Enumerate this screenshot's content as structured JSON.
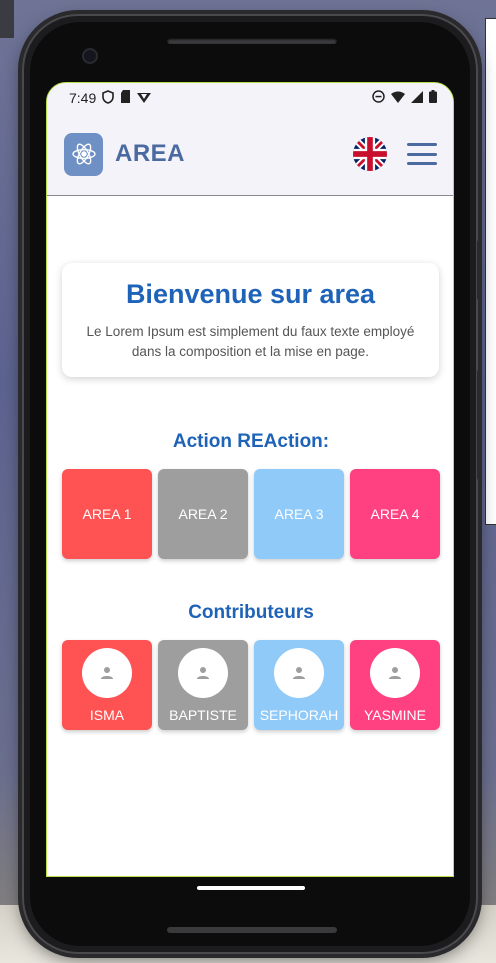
{
  "status_bar": {
    "time": "7:49"
  },
  "appbar": {
    "brand": "AREA",
    "logo_icon": "atom-icon",
    "language_flag": "uk-flag-icon",
    "menu_icon": "hamburger-menu-icon"
  },
  "welcome": {
    "title": "Bienvenue sur area",
    "description": "Le Lorem Ipsum est simplement du faux texte employé dans la composition et la mise en page."
  },
  "actions": {
    "title": "Action REAction:",
    "items": [
      {
        "label": "AREA 1",
        "color": "#ff5252"
      },
      {
        "label": "AREA 2",
        "color": "#9e9e9e"
      },
      {
        "label": "AREA 3",
        "color": "#90caf9"
      },
      {
        "label": "AREA 4",
        "color": "#ff4081"
      }
    ]
  },
  "contributors": {
    "title": "Contributeurs",
    "items": [
      {
        "name": "ISMA",
        "color": "#ff5252"
      },
      {
        "name": "BAPTISTE",
        "color": "#9e9e9e"
      },
      {
        "name": "SEPHORAH",
        "color": "#90caf9"
      },
      {
        "name": "YASMINE",
        "color": "#ff4081"
      }
    ]
  },
  "colors": {
    "primary": "#1e63b8",
    "brand": "#4a6aa0",
    "appbar_bg": "#f4f3fa"
  }
}
